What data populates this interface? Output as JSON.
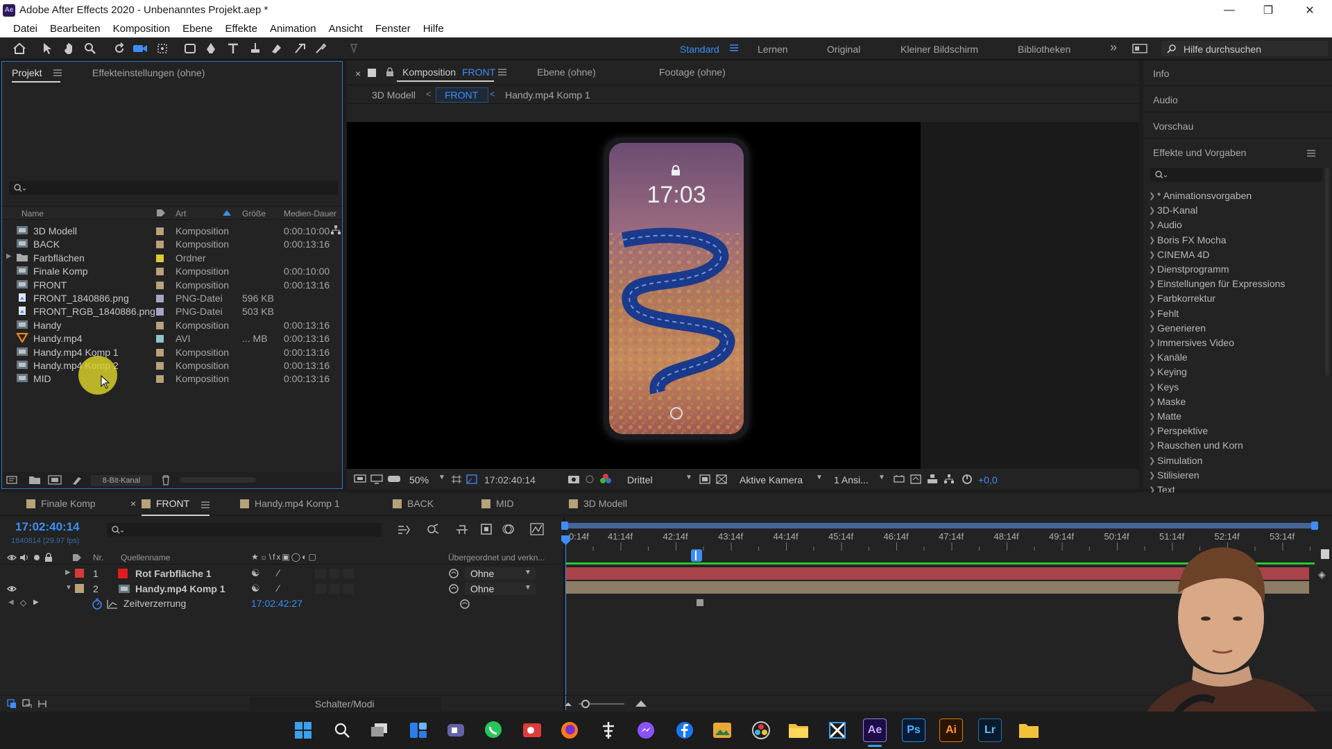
{
  "window": {
    "title": "Adobe After Effects 2020 - Unbenanntes Projekt.aep *",
    "app_badge": "Ae"
  },
  "menu": [
    "Datei",
    "Bearbeiten",
    "Komposition",
    "Ebene",
    "Effekte",
    "Animation",
    "Ansicht",
    "Fenster",
    "Hilfe"
  ],
  "workspaces": {
    "standard": "Standard",
    "lernen": "Lernen",
    "original": "Original",
    "kleiner": "Kleiner Bildschirm",
    "bibliotheken": "Bibliotheken",
    "more": "»"
  },
  "help_search": {
    "placeholder": "Hilfe durchsuchen"
  },
  "project_panel": {
    "tab_project": "Projekt",
    "tab_effects": "Effekteinstellungen (ohne)",
    "columns": {
      "name": "Name",
      "type": "Art",
      "size": "Größe",
      "duration": "Medien-Dauer"
    },
    "items": [
      {
        "name": "3D Modell",
        "type": "Komposition",
        "size": "",
        "duration": "0:00:10:00",
        "icon": "composition-icon",
        "label_color": "#b8a27a"
      },
      {
        "name": "BACK",
        "type": "Komposition",
        "size": "",
        "duration": "0:00:13:16",
        "icon": "composition-icon",
        "label_color": "#b8a27a"
      },
      {
        "name": "Farbflächen",
        "type": "Ordner",
        "size": "",
        "duration": "",
        "icon": "folder-icon",
        "label_color": "#e0c930"
      },
      {
        "name": "Finale Komp",
        "type": "Komposition",
        "size": "",
        "duration": "0:00:10:00",
        "icon": "composition-icon",
        "label_color": "#b8a27a"
      },
      {
        "name": "FRONT",
        "type": "Komposition",
        "size": "",
        "duration": "0:00:13:16",
        "icon": "composition-icon",
        "label_color": "#b8a27a"
      },
      {
        "name": "FRONT_1840886.png",
        "type": "PNG-Datei",
        "size": "596 KB",
        "duration": "",
        "icon": "image-file-icon",
        "label_color": "#a9a3c9"
      },
      {
        "name": "FRONT_RGB_1840886.png",
        "type": "PNG-Datei",
        "size": "503 KB",
        "duration": "",
        "icon": "image-file-icon",
        "label_color": "#a9a3c9"
      },
      {
        "name": "Handy",
        "type": "Komposition",
        "size": "",
        "duration": "0:00:13:16",
        "icon": "composition-icon",
        "label_color": "#b8a27a"
      },
      {
        "name": "Handy.mp4",
        "type": "AVI",
        "size": "... MB",
        "duration": "0:00:13:16",
        "icon": "video-file-icon",
        "label_color": "#8fc7c4"
      },
      {
        "name": "Handy.mp4 Komp 1",
        "type": "Komposition",
        "size": "",
        "duration": "0:00:13:16",
        "icon": "composition-icon",
        "label_color": "#b8a27a"
      },
      {
        "name": "Handy.mp4 Komp 2",
        "type": "Komposition",
        "size": "",
        "duration": "0:00:13:16",
        "icon": "composition-icon",
        "label_color": "#b8a27a"
      },
      {
        "name": "MID",
        "type": "Komposition",
        "size": "",
        "duration": "0:00:13:16",
        "icon": "composition-icon",
        "label_color": "#b8a27a"
      }
    ],
    "bit_depth": "8-Bit-Kanal"
  },
  "comp_panel": {
    "tab_prefix": "Komposition",
    "tab_comp": "FRONT",
    "tab_layer": "Ebene (ohne)",
    "tab_footage": "Footage (ohne)",
    "breadcrumb": [
      "3D Modell",
      "FRONT",
      "Handy.mp4 Komp 1"
    ],
    "phone_clock": "17:03",
    "footer": {
      "zoom": "50%",
      "timecode": "17:02:40:14",
      "grid": "Drittel",
      "camera": "Aktive Kamera",
      "views": "1 Ansi...",
      "exposure": "+0,0"
    }
  },
  "right_panel": {
    "info": "Info",
    "audio": "Audio",
    "preview": "Vorschau",
    "effects_title": "Effekte und Vorgaben",
    "effects": [
      "* Animationsvorgaben",
      "3D-Kanal",
      "Audio",
      "Boris FX Mocha",
      "CINEMA 4D",
      "Dienstprogramm",
      "Einstellungen für Expressions",
      "Farbkorrektur",
      "Fehlt",
      "Generieren",
      "Immersives Video",
      "Kanäle",
      "Keying",
      "Keys",
      "Maske",
      "Matte",
      "Perspektive",
      "Rauschen und Korn",
      "Simulation",
      "Stilisieren",
      "Text"
    ]
  },
  "timeline": {
    "tabs": [
      {
        "label": "Finale Komp",
        "color": "#b8a27a"
      },
      {
        "label": "FRONT",
        "color": "#b8a27a"
      },
      {
        "label": "Handy.mp4 Komp 1",
        "color": "#b8a27a"
      },
      {
        "label": "BACK",
        "color": "#b8a27a"
      },
      {
        "label": "MID",
        "color": "#b8a27a"
      },
      {
        "label": "3D Modell",
        "color": "#b8a27a"
      }
    ],
    "current_time": "17:02:40:14",
    "fps_line": "1840814 (29.97 fps)",
    "headers": {
      "nr": "Nr.",
      "source": "Quellenname",
      "parent": "Übergeordnet und verkn..."
    },
    "layers": [
      {
        "nr": "1",
        "name": "Rot Farbfläche 1",
        "parent": "Ohne",
        "color": "#d83a3a"
      },
      {
        "nr": "2",
        "name": "Handy.mp4 Komp 1",
        "parent": "Ohne",
        "color": "#b8a27a"
      }
    ],
    "property": {
      "name": "Zeitverzerrung",
      "value": "17:02:42:27"
    },
    "ruler_labels": [
      "41:14f",
      "42:14f",
      "43:14f",
      "44:14f",
      "45:14f",
      "46:14f",
      "47:14f",
      "48:14f",
      "49:14f",
      "50:14f",
      "51:14f",
      "52:14f",
      "53:14f"
    ],
    "first_label": "0:14f",
    "mode_label": "Schalter/Modi"
  },
  "taskbar": {
    "apps": [
      "windows-start",
      "search",
      "task-view",
      "widgets",
      "teams",
      "whatsapp",
      "screen-recorder",
      "firefox",
      "bluetooth-tool",
      "messenger",
      "facebook",
      "photos",
      "davinci",
      "file-explorer",
      "capcut",
      "after-effects",
      "photoshop",
      "illustrator",
      "lightroom",
      "folder"
    ],
    "ae": "Ae",
    "ps": "Ps",
    "ai": "Ai",
    "lr": "Lr"
  }
}
